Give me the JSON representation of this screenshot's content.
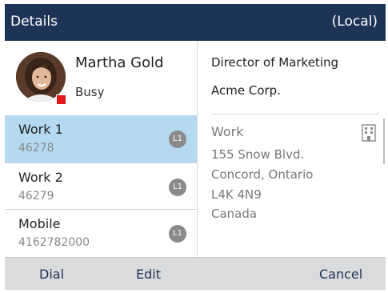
{
  "header": {
    "title": "Details",
    "location": "(Local)"
  },
  "contact": {
    "name": "Martha Gold",
    "status": "Busy",
    "status_color": "#e5171d",
    "avatar_icon": "person-photo"
  },
  "numbers": [
    {
      "label": "Work 1",
      "value": "46278",
      "line": "L1",
      "selected": true
    },
    {
      "label": "Work 2",
      "value": "46279",
      "line": "L1",
      "selected": false
    },
    {
      "label": "Mobile",
      "value": "4162782000",
      "line": "L1",
      "selected": false
    }
  ],
  "details": {
    "job_title": "Director of Marketing",
    "company": "Acme Corp.",
    "address_label": "Work",
    "address_icon": "building-icon",
    "address_lines": [
      "155 Snow Blvd.",
      "Concord, Ontario",
      "L4K 4N9",
      "Canada"
    ]
  },
  "softkeys": {
    "dial": "Dial",
    "edit": "Edit",
    "cancel": "Cancel"
  },
  "colors": {
    "header_bg": "#1e3456",
    "selected_bg": "#b5d9f1",
    "footer_bg": "#d9dbdd"
  }
}
